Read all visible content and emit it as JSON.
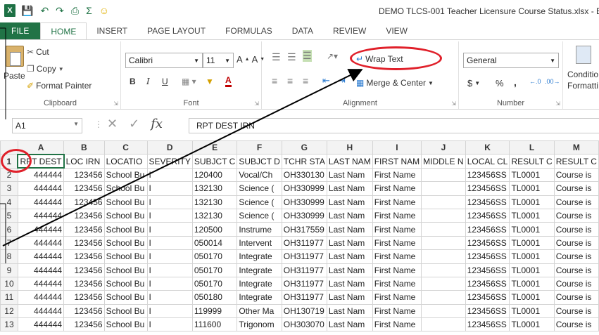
{
  "window": {
    "title": "DEMO TLCS-001 Teacher Licensure Course Status.xlsx - E",
    "logo": "X"
  },
  "qat": {
    "save_icon": "save-icon",
    "undo_icon": "undo-icon",
    "redo_icon": "redo-icon",
    "autosum_icon": "sigma-icon",
    "smiley_icon": "smiley-icon"
  },
  "tabs": [
    "FILE",
    "HOME",
    "INSERT",
    "PAGE LAYOUT",
    "FORMULAS",
    "DATA",
    "REVIEW",
    "VIEW"
  ],
  "ribbon": {
    "clipboard": {
      "label": "Clipboard",
      "paste": "Paste",
      "cut": "Cut",
      "copy": "Copy",
      "format_painter": "Format Painter"
    },
    "font": {
      "label": "Font",
      "font_name": "Calibri",
      "font_size": "11",
      "bold": "B",
      "italic": "I",
      "underline": "U"
    },
    "alignment": {
      "label": "Alignment",
      "wrap_text": "Wrap Text",
      "merge_center": "Merge & Center"
    },
    "number": {
      "label": "Number",
      "format": "General",
      "currency": "$",
      "percent": "%",
      "comma": ","
    },
    "styles": {
      "conditional": "Conditio",
      "formatting": "Formatti"
    }
  },
  "formula_bar": {
    "name_box": "A1",
    "fx": "fx",
    "value": "RPT DEST IRN"
  },
  "sheet": {
    "columns": [
      "A",
      "B",
      "C",
      "D",
      "E",
      "F",
      "G",
      "H",
      "I",
      "J",
      "K",
      "L",
      "M"
    ],
    "header_row": [
      "RPT DEST",
      "LOC IRN",
      "LOCATIO",
      "SEVERITY",
      "SUBJCT C",
      "SUBJCT D",
      "TCHR STA",
      "LAST NAM",
      "FIRST NAM",
      "MIDDLE N",
      "LOCAL CL",
      "RESULT C",
      "RESULT C"
    ],
    "rows": [
      [
        "444444",
        "123456",
        "School Bu",
        "I",
        "120400",
        "Vocal/Ch",
        "OH330130",
        "Last Nam",
        "First Name",
        "",
        "123456SS",
        "TL0001",
        "Course is"
      ],
      [
        "444444",
        "123456",
        "School Bu",
        "I",
        "132130",
        "Science (",
        "OH330999",
        "Last Nam",
        "First Name",
        "",
        "123456SS",
        "TL0001",
        "Course is"
      ],
      [
        "444444",
        "123456",
        "School Bu",
        "I",
        "132130",
        "Science (",
        "OH330999",
        "Last Nam",
        "First Name",
        "",
        "123456SS",
        "TL0001",
        "Course is"
      ],
      [
        "444444",
        "123456",
        "School Bu",
        "I",
        "132130",
        "Science (",
        "OH330999",
        "Last Nam",
        "First Name",
        "",
        "123456SS",
        "TL0001",
        "Course is"
      ],
      [
        "444444",
        "123456",
        "School Bu",
        "I",
        "120500",
        "Instrume",
        "OH317559",
        "Last Nam",
        "First Name",
        "",
        "123456SS",
        "TL0001",
        "Course is"
      ],
      [
        "444444",
        "123456",
        "School Bu",
        "I",
        "050014",
        "Intervent",
        "OH311977",
        "Last Nam",
        "First Name",
        "",
        "123456SS",
        "TL0001",
        "Course is"
      ],
      [
        "444444",
        "123456",
        "School Bu",
        "I",
        "050170",
        "Integrate",
        "OH311977",
        "Last Nam",
        "First Name",
        "",
        "123456SS",
        "TL0001",
        "Course is"
      ],
      [
        "444444",
        "123456",
        "School Bu",
        "I",
        "050170",
        "Integrate",
        "OH311977",
        "Last Nam",
        "First Name",
        "",
        "123456SS",
        "TL0001",
        "Course is"
      ],
      [
        "444444",
        "123456",
        "School Bu",
        "I",
        "050170",
        "Integrate",
        "OH311977",
        "Last Nam",
        "First Name",
        "",
        "123456SS",
        "TL0001",
        "Course is"
      ],
      [
        "444444",
        "123456",
        "School Bu",
        "I",
        "050180",
        "Integrate",
        "OH311977",
        "Last Nam",
        "First Name",
        "",
        "123456SS",
        "TL0001",
        "Course is"
      ],
      [
        "444444",
        "123456",
        "School Bu",
        "I",
        "119999",
        "Other Ma",
        "OH130719",
        "Last Nam",
        "First Name",
        "",
        "123456SS",
        "TL0001",
        "Course is"
      ],
      [
        "444444",
        "123456",
        "School Bu",
        "I",
        "111600",
        "Trigonom",
        "OH303070",
        "Last Nam",
        "First Name",
        "",
        "123456SS",
        "TL0001",
        "Course is"
      ]
    ]
  },
  "annotations": {
    "highlight_color": "#e0202a"
  }
}
